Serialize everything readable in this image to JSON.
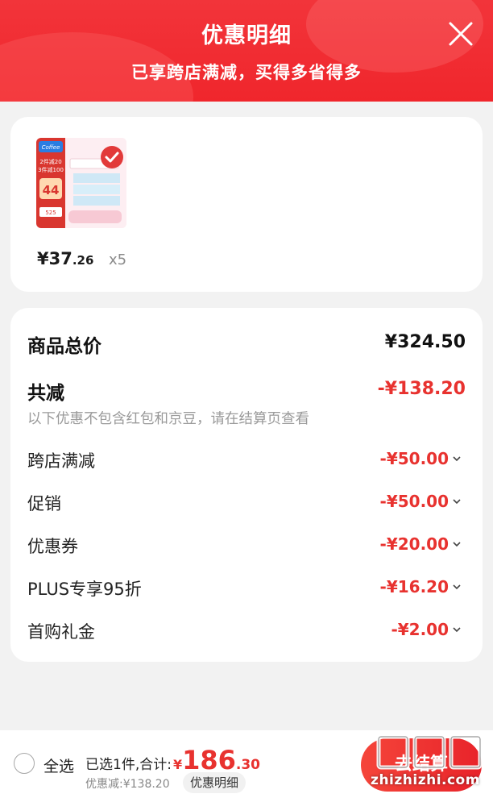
{
  "header": {
    "title": "优惠明细",
    "subtitle": "已享跨店满减，买得多省得多",
    "bg_color": "#f0262c"
  },
  "product": {
    "image_text": {
      "brand": "Coffee",
      "promo_line1": "2件减20",
      "promo_line2": "3件减100",
      "price_tag": "44",
      "price_tag2": "525"
    },
    "price_yen": "¥37",
    "price_cents": ".26",
    "quantity": "x5"
  },
  "summary": {
    "total_label": "商品总价",
    "total_value": "¥324.50",
    "discount_label": "共减",
    "discount_value": "-¥138.20",
    "discount_note": "以下优惠不包含红包和京豆，请在结算页查看",
    "items": [
      {
        "label": "跨店满减",
        "value": "-¥50.00"
      },
      {
        "label": "促销",
        "value": "-¥50.00"
      },
      {
        "label": "优惠券",
        "value": "-¥20.00"
      },
      {
        "label": "PLUS专享95折",
        "value": "-¥16.20"
      },
      {
        "label": "首购礼金",
        "value": "-¥2.00"
      }
    ]
  },
  "bottom_bar": {
    "select_all_label": "全选",
    "selected_text": "已选1件,合计:",
    "total_yen": "¥",
    "total_int": "186",
    "total_dec": ".30",
    "discount_text": "优惠减:¥138.20",
    "detail_button": "优惠明细",
    "checkout_label": "去结算"
  },
  "watermark": {
    "logo_text": "值值值",
    "site": "zhizhizhi.com"
  },
  "colors": {
    "accent_red": "#e8322f",
    "background": "#f2f2f2"
  }
}
